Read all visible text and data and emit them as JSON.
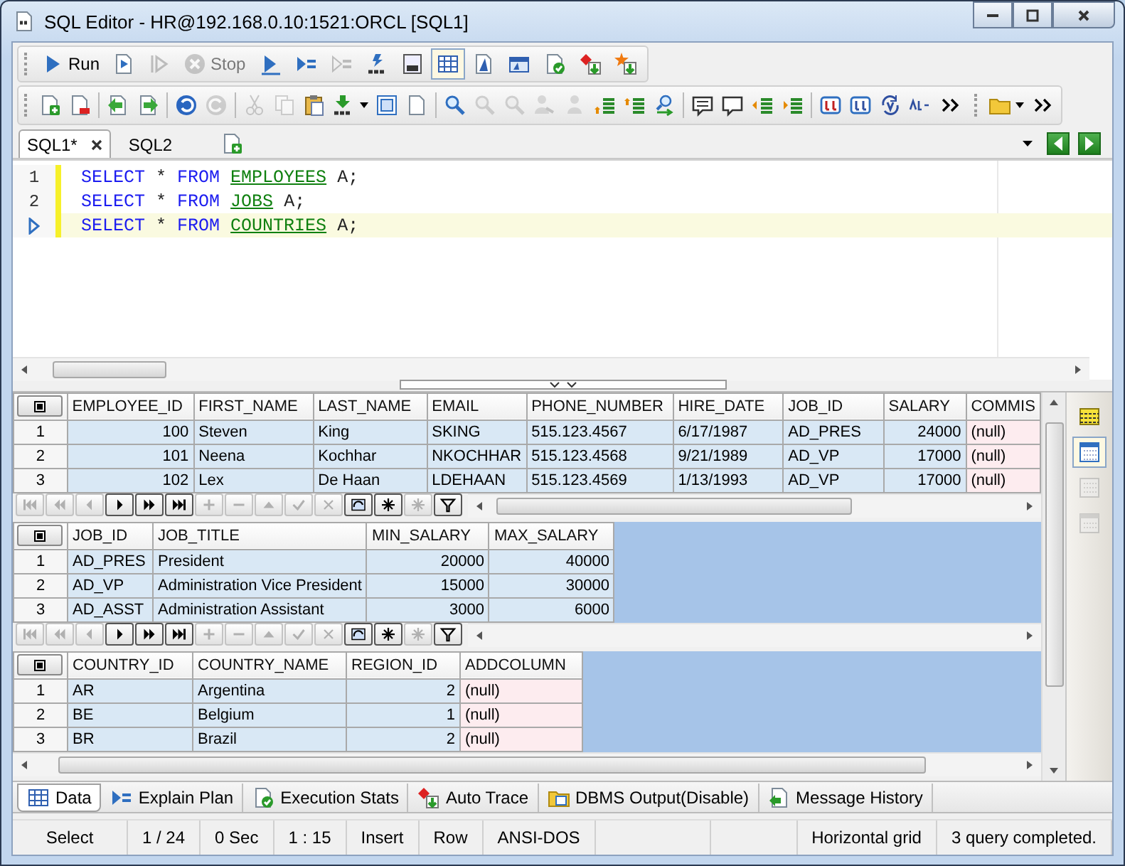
{
  "window": {
    "title": "SQL Editor - HR@192.168.0.10:1521:ORCL [SQL1]"
  },
  "toolbar_1": [
    {
      "label": "Run",
      "disabled": false,
      "pressed": false
    },
    {
      "disabled": false,
      "pressed": false
    },
    {
      "disabled": true,
      "pressed": false
    },
    {
      "label": "Stop",
      "disabled": true,
      "pressed": false
    },
    {
      "disabled": false,
      "pressed": false
    },
    {
      "disabled": false,
      "pressed": false
    },
    {
      "disabled": true,
      "pressed": false
    },
    {
      "disabled": false,
      "pressed": false
    },
    {
      "disabled": false,
      "pressed": false
    },
    {
      "disabled": false,
      "pressed": true
    },
    {
      "disabled": false,
      "pressed": false
    },
    {
      "disabled": false,
      "pressed": false
    },
    {
      "disabled": false,
      "pressed": false
    },
    {
      "disabled": false,
      "pressed": false
    },
    {
      "disabled": false,
      "pressed": false
    }
  ],
  "toolbar_2": [
    {
      "disabled": false
    },
    {
      "disabled": false
    },
    {
      "disabled": false
    },
    {
      "disabled": false
    },
    {
      "disabled": false
    },
    {
      "disabled": true
    },
    {
      "disabled": true
    },
    {
      "disabled": true
    },
    {
      "disabled": false
    },
    {
      "disabled": false
    },
    {
      "disabled": false
    },
    {
      "disabled": false
    },
    {
      "disabled": false
    },
    {
      "disabled": true
    },
    {
      "disabled": true
    },
    {
      "disabled": true
    },
    {
      "disabled": true
    },
    {
      "disabled": false
    },
    {
      "disabled": false
    },
    {
      "disabled": false
    },
    {
      "disabled": false
    },
    {
      "disabled": false
    },
    {
      "disabled": false
    },
    {
      "disabled": false
    },
    {
      "disabled": false
    },
    {
      "disabled": false
    },
    {
      "disabled": false
    },
    {
      "disabled": false
    },
    {
      "disabled": false
    },
    {
      "disabled": false
    },
    {
      "disabled": false
    }
  ],
  "editor_tabs": [
    {
      "label": "SQL1*",
      "selected": true
    },
    {
      "label": "SQL2",
      "selected": false
    }
  ],
  "editor": {
    "lines": [
      {
        "number": "1",
        "current": false,
        "tokens": [
          {
            "text": "SELECT",
            "kind": "keyword"
          },
          {
            "text": " * ",
            "kind": "plain"
          },
          {
            "text": "FROM",
            "kind": "keyword"
          },
          {
            "text": "EMPLOYEES",
            "kind": "object"
          },
          {
            "text": " A;",
            "kind": "plain"
          }
        ]
      },
      {
        "number": "2",
        "current": false,
        "tokens": [
          {
            "text": "SELECT",
            "kind": "keyword"
          },
          {
            "text": " * ",
            "kind": "plain"
          },
          {
            "text": "FROM",
            "kind": "keyword"
          },
          {
            "text": "JOBS",
            "kind": "object"
          },
          {
            "text": " A;",
            "kind": "plain"
          }
        ]
      },
      {
        "current": true,
        "tokens": [
          {
            "text": "SELECT",
            "kind": "keyword"
          },
          {
            "text": " * ",
            "kind": "plain"
          },
          {
            "text": "FROM",
            "kind": "keyword"
          },
          {
            "text": "COUNTRIES",
            "kind": "object"
          },
          {
            "text": " A;",
            "kind": "plain"
          }
        ]
      }
    ]
  },
  "grids": [
    {
      "columns": [
        {
          "name": "EMPLOYEE_ID",
          "kind": "number"
        },
        {
          "name": "FIRST_NAME",
          "kind": "text"
        },
        {
          "name": "LAST_NAME",
          "kind": "text"
        },
        {
          "name": "EMAIL",
          "kind": "text"
        },
        {
          "name": "PHONE_NUMBER",
          "kind": "text"
        },
        {
          "name": "HIRE_DATE",
          "kind": "text"
        },
        {
          "name": "JOB_ID",
          "kind": "text"
        },
        {
          "name": "SALARY",
          "kind": "number"
        },
        {
          "name": "COMMIS",
          "kind": "null"
        }
      ],
      "rows": [
        {
          "number": "1",
          "cells": [
            "100",
            "Steven",
            "King",
            "SKING",
            "515.123.4567",
            "6/17/1987",
            "AD_PRES",
            "24000",
            "(null)"
          ]
        },
        {
          "number": "2",
          "cells": [
            "101",
            "Neena",
            "Kochhar",
            "NKOCHHAR",
            "515.123.4568",
            "9/21/1989",
            "AD_VP",
            "17000",
            "(null)"
          ]
        },
        {
          "number": "3",
          "cells": [
            "102",
            "Lex",
            "De Haan",
            "LDEHAAN",
            "515.123.4569",
            "1/13/1993",
            "AD_VP",
            "17000",
            "(null)"
          ]
        }
      ],
      "navigator": [
        {
          "disabled": true
        },
        {
          "disabled": true
        },
        {
          "disabled": true
        },
        {
          "disabled": false
        },
        {
          "disabled": false
        },
        {
          "disabled": false
        },
        {
          "disabled": true
        },
        {
          "disabled": true
        },
        {
          "disabled": true
        },
        {
          "disabled": true
        },
        {
          "disabled": true
        },
        {
          "disabled": false
        },
        {
          "disabled": false
        },
        {
          "disabled": true
        },
        {
          "disabled": false
        }
      ]
    },
    {
      "columns": [
        {
          "name": "JOB_ID",
          "kind": "text"
        },
        {
          "name": "JOB_TITLE",
          "kind": "text"
        },
        {
          "name": "MIN_SALARY",
          "kind": "number"
        },
        {
          "name": "MAX_SALARY",
          "kind": "number"
        }
      ],
      "rows": [
        {
          "number": "1",
          "cells": [
            "AD_PRES",
            "President",
            "20000",
            "40000"
          ]
        },
        {
          "number": "2",
          "cells": [
            "AD_VP",
            "Administration Vice President",
            "15000",
            "30000"
          ]
        },
        {
          "number": "3",
          "cells": [
            "AD_ASST",
            "Administration Assistant",
            "3000",
            "6000"
          ]
        }
      ],
      "navigator": [
        {
          "disabled": true
        },
        {
          "disabled": true
        },
        {
          "disabled": true
        },
        {
          "disabled": false
        },
        {
          "disabled": false
        },
        {
          "disabled": false
        },
        {
          "disabled": true
        },
        {
          "disabled": true
        },
        {
          "disabled": true
        },
        {
          "disabled": true
        },
        {
          "disabled": true
        },
        {
          "disabled": false
        },
        {
          "disabled": false
        },
        {
          "disabled": true
        },
        {
          "disabled": false
        }
      ]
    },
    {
      "columns": [
        {
          "name": "COUNTRY_ID",
          "kind": "text"
        },
        {
          "name": "COUNTRY_NAME",
          "kind": "text"
        },
        {
          "name": "REGION_ID",
          "kind": "number"
        },
        {
          "name": "ADDCOLUMN",
          "kind": "null"
        }
      ],
      "rows": [
        {
          "number": "1",
          "cells": [
            "AR",
            "Argentina",
            "2",
            "(null)"
          ]
        },
        {
          "number": "2",
          "cells": [
            "BE",
            "Belgium",
            "1",
            "(null)"
          ]
        },
        {
          "number": "3",
          "cells": [
            "BR",
            "Brazil",
            "2",
            "(null)"
          ]
        }
      ]
    }
  ],
  "side_views": [
    {
      "disabled": false,
      "selected": false
    },
    {
      "disabled": false,
      "selected": true
    },
    {
      "disabled": true,
      "selected": false
    },
    {
      "disabled": true,
      "selected": false
    }
  ],
  "result_tabs": [
    {
      "label": "Data",
      "selected": true
    },
    {
      "label": "Explain Plan",
      "selected": false
    },
    {
      "label": "Execution Stats",
      "selected": false
    },
    {
      "label": "Auto Trace",
      "selected": false
    },
    {
      "label": "DBMS Output(Disable)",
      "selected": false
    },
    {
      "label": "Message History",
      "selected": false
    }
  ],
  "status_bar": {
    "left": [
      "Select",
      "1 / 24",
      "0 Sec",
      "1 : 15",
      "Insert",
      "Row",
      "ANSI-DOS"
    ],
    "right": [
      "Horizontal grid",
      "3 query completed."
    ]
  }
}
